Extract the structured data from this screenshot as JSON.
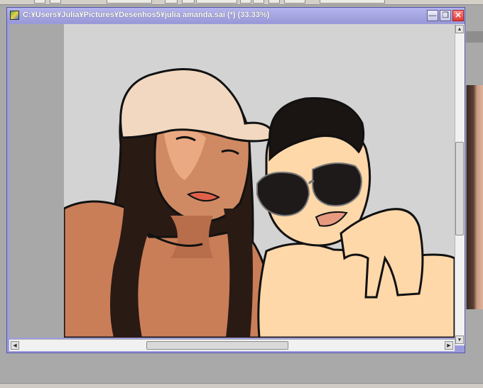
{
  "window": {
    "title": "C:¥Users¥Julia¥Pictures¥Desenhos5¥julia amanda.sai (*) (33.33%)",
    "buttons": {
      "minimize_icon": "minimize-icon",
      "restore_icon": "restore-icon",
      "close_icon": "close-icon"
    }
  },
  "canvas": {
    "document": "julia amanda.sai",
    "zoom": "33.33%",
    "colors": {
      "workspace": "#a8a8a8",
      "artboard": "#d3d3d3",
      "skin_left": "#e8a07a",
      "skin_right": "#ffd8aa",
      "hair": "#2a1a14",
      "cap": "#f2d8c0"
    }
  },
  "scrollbars": {
    "vertical": {
      "position": 0.55
    },
    "horizontal": {
      "position": 0.45
    }
  }
}
